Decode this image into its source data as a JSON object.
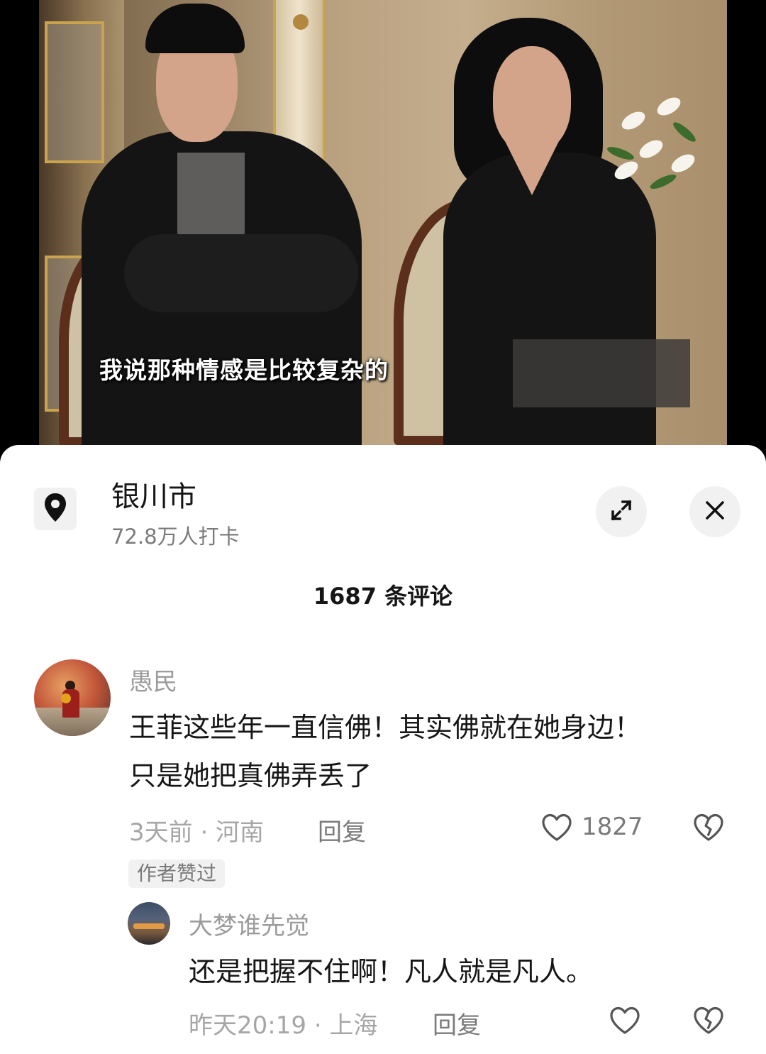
{
  "video": {
    "subtitle": "我说那种情感是比较复杂的"
  },
  "location": {
    "title": "银川市",
    "checkins": "72.8万人打卡",
    "icon": "location-pin-icon"
  },
  "header": {
    "comment_count": "1687 条评论",
    "expand_icon": "expand-icon",
    "close_icon": "close-icon"
  },
  "comments": [
    {
      "username": "愚民",
      "text_line1": "王菲这些年一直信佛！其实佛就在她身边！",
      "text_line2": "只是她把真佛弄丢了",
      "meta": "3天前 · 河南",
      "reply_label": "回复",
      "likes": "1827",
      "tag": "作者赞过"
    },
    {
      "username": "大梦谁先觉",
      "text": "还是把握不住啊！凡人就是凡人。",
      "meta": "昨天20:19 · 上海",
      "reply_label": "回复"
    }
  ],
  "colors": {
    "sheet_bg": "#ffffff",
    "primary_text": "#161616",
    "secondary_text": "#9b9b9b",
    "chip_bg": "#f1f1f1"
  }
}
